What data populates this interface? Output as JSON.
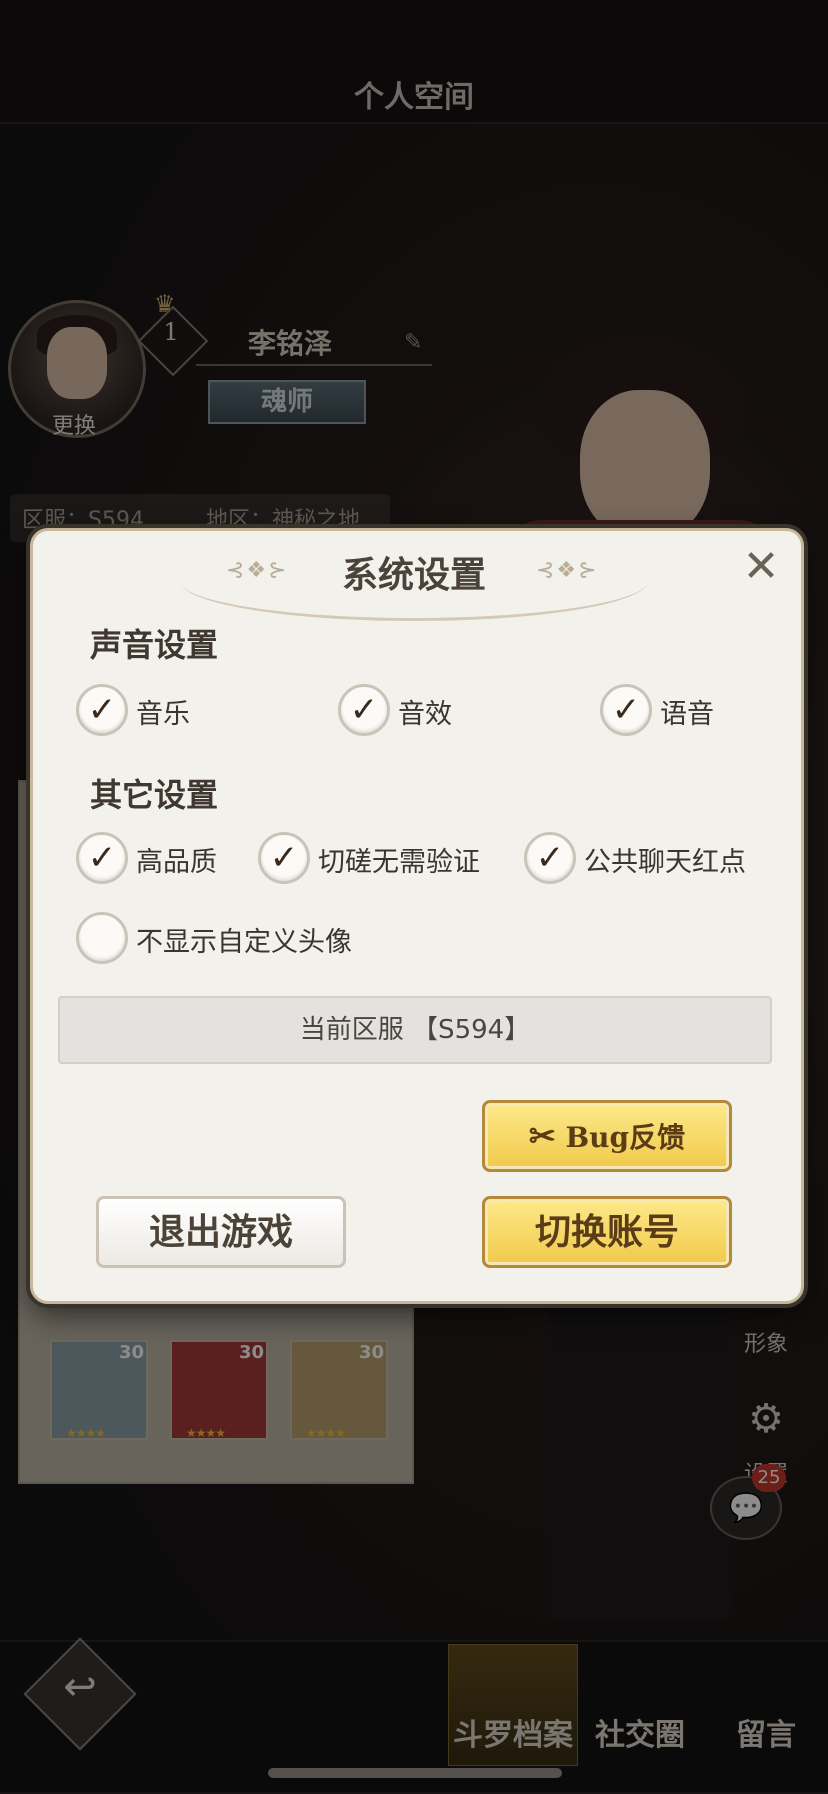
{
  "header": {
    "title": "个人空间"
  },
  "profile": {
    "avatar_change": "更换",
    "level": "1",
    "name": "李铭泽",
    "title_plate": "魂师",
    "server_label": "区服：S594",
    "region_label": "地区：神秘之地"
  },
  "cards": [
    "30",
    "30",
    "30"
  ],
  "side": {
    "image_label": "形象",
    "settings_label": "设置",
    "chat_badge": "25"
  },
  "bottom_nav": {
    "archive": "斗罗档案",
    "social": "社交圈",
    "message": "留言"
  },
  "dialog": {
    "title": "系统设置",
    "sound_section": "声音设置",
    "sound_options": [
      {
        "label": "音乐",
        "checked": true
      },
      {
        "label": "音效",
        "checked": true
      },
      {
        "label": "语音",
        "checked": true
      }
    ],
    "other_section": "其它设置",
    "other_options": [
      {
        "label": "高品质",
        "checked": true
      },
      {
        "label": "切磋无需验证",
        "checked": true
      },
      {
        "label": "公共聊天红点",
        "checked": true
      },
      {
        "label": "不显示自定义头像",
        "checked": false
      }
    ],
    "current_server": "当前区服 【S594】",
    "bug_button": "Bug反馈",
    "exit_button": "退出游戏",
    "switch_button": "切换账号"
  },
  "colors": {
    "gold": "#f1c94b",
    "dialog_bg": "#f3f1ec",
    "badge": "#c8382c"
  }
}
